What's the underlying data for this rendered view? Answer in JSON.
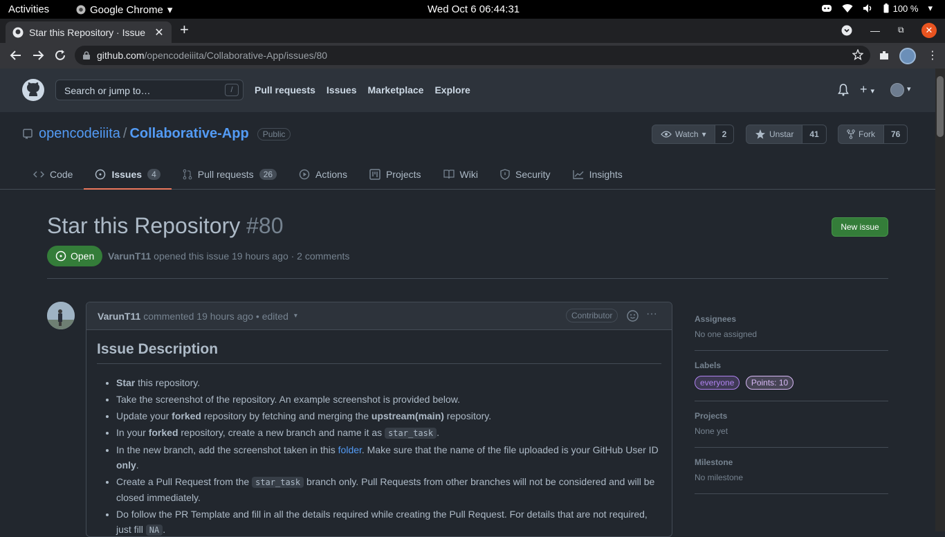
{
  "os": {
    "activities": "Activities",
    "app": "Google Chrome",
    "clock": "Wed Oct 6  06:44:31",
    "battery": "100 %"
  },
  "browser": {
    "tab_title": "Star this Repository · Issue",
    "url_host": "github.com",
    "url_path": "/opencodeiiita/Collaborative-App/issues/80"
  },
  "github": {
    "search_placeholder": "Search or jump to…",
    "search_key": "/",
    "nav": [
      "Pull requests",
      "Issues",
      "Marketplace",
      "Explore"
    ]
  },
  "repo": {
    "owner": "opencodeiiita",
    "sep": "/",
    "name": "Collaborative-App",
    "visibility": "Public",
    "watch_label": "Watch",
    "watch_count": "2",
    "star_label": "Unstar",
    "star_count": "41",
    "fork_label": "Fork",
    "fork_count": "76",
    "tabs": [
      {
        "label": "Code",
        "count": ""
      },
      {
        "label": "Issues",
        "count": "4"
      },
      {
        "label": "Pull requests",
        "count": "26"
      },
      {
        "label": "Actions",
        "count": ""
      },
      {
        "label": "Projects",
        "count": ""
      },
      {
        "label": "Wiki",
        "count": ""
      },
      {
        "label": "Security",
        "count": ""
      },
      {
        "label": "Insights",
        "count": ""
      }
    ]
  },
  "issue": {
    "title": "Star this Repository",
    "number": "#80",
    "new_issue": "New issue",
    "state": "Open",
    "author": "VarunT11",
    "opened_text": "opened this issue 19 hours ago · 2 comments"
  },
  "comment": {
    "author": "VarunT11",
    "meta": "commented 19 hours ago • edited",
    "role": "Contributor",
    "heading": "Issue Description",
    "items": {
      "i1_bold": "Star",
      "i1_rest": " this repository.",
      "i2": "Take the screenshot of the repository. An example screenshot is provided below.",
      "i3_a": "Update your ",
      "i3_b": "forked",
      "i3_c": " repository by fetching and merging the ",
      "i3_d": "upstream(main)",
      "i3_e": " repository.",
      "i4_a": "In your ",
      "i4_b": "forked",
      "i4_c": " repository, create a new branch and name it as ",
      "i4_code": "star_task",
      "i4_d": ".",
      "i5_a": "In the new branch, add the screenshot taken in this ",
      "i5_link": "folder",
      "i5_b": ". Make sure that the name of the file uploaded is your GitHub User ID ",
      "i5_c": "only",
      "i5_d": ".",
      "i6_a": "Create a Pull Request from the ",
      "i6_code": "star_task",
      "i6_b": " branch only. Pull Requests from other branches will not be considered and will be closed immediately.",
      "i7_a": "Do follow the PR Template and fill in all the details required while creating the Pull Request. For details that are not required, just fill ",
      "i7_code": "NA",
      "i7_b": "."
    }
  },
  "sidebar": {
    "assignees_h": "Assignees",
    "assignees_v": "No one assigned",
    "labels_h": "Labels",
    "labels": [
      {
        "name": "everyone",
        "color": "#b083f0"
      },
      {
        "name": "Points: 10",
        "color": "#d7b8f5"
      }
    ],
    "projects_h": "Projects",
    "projects_v": "None yet",
    "milestone_h": "Milestone",
    "milestone_v": "No milestone"
  }
}
